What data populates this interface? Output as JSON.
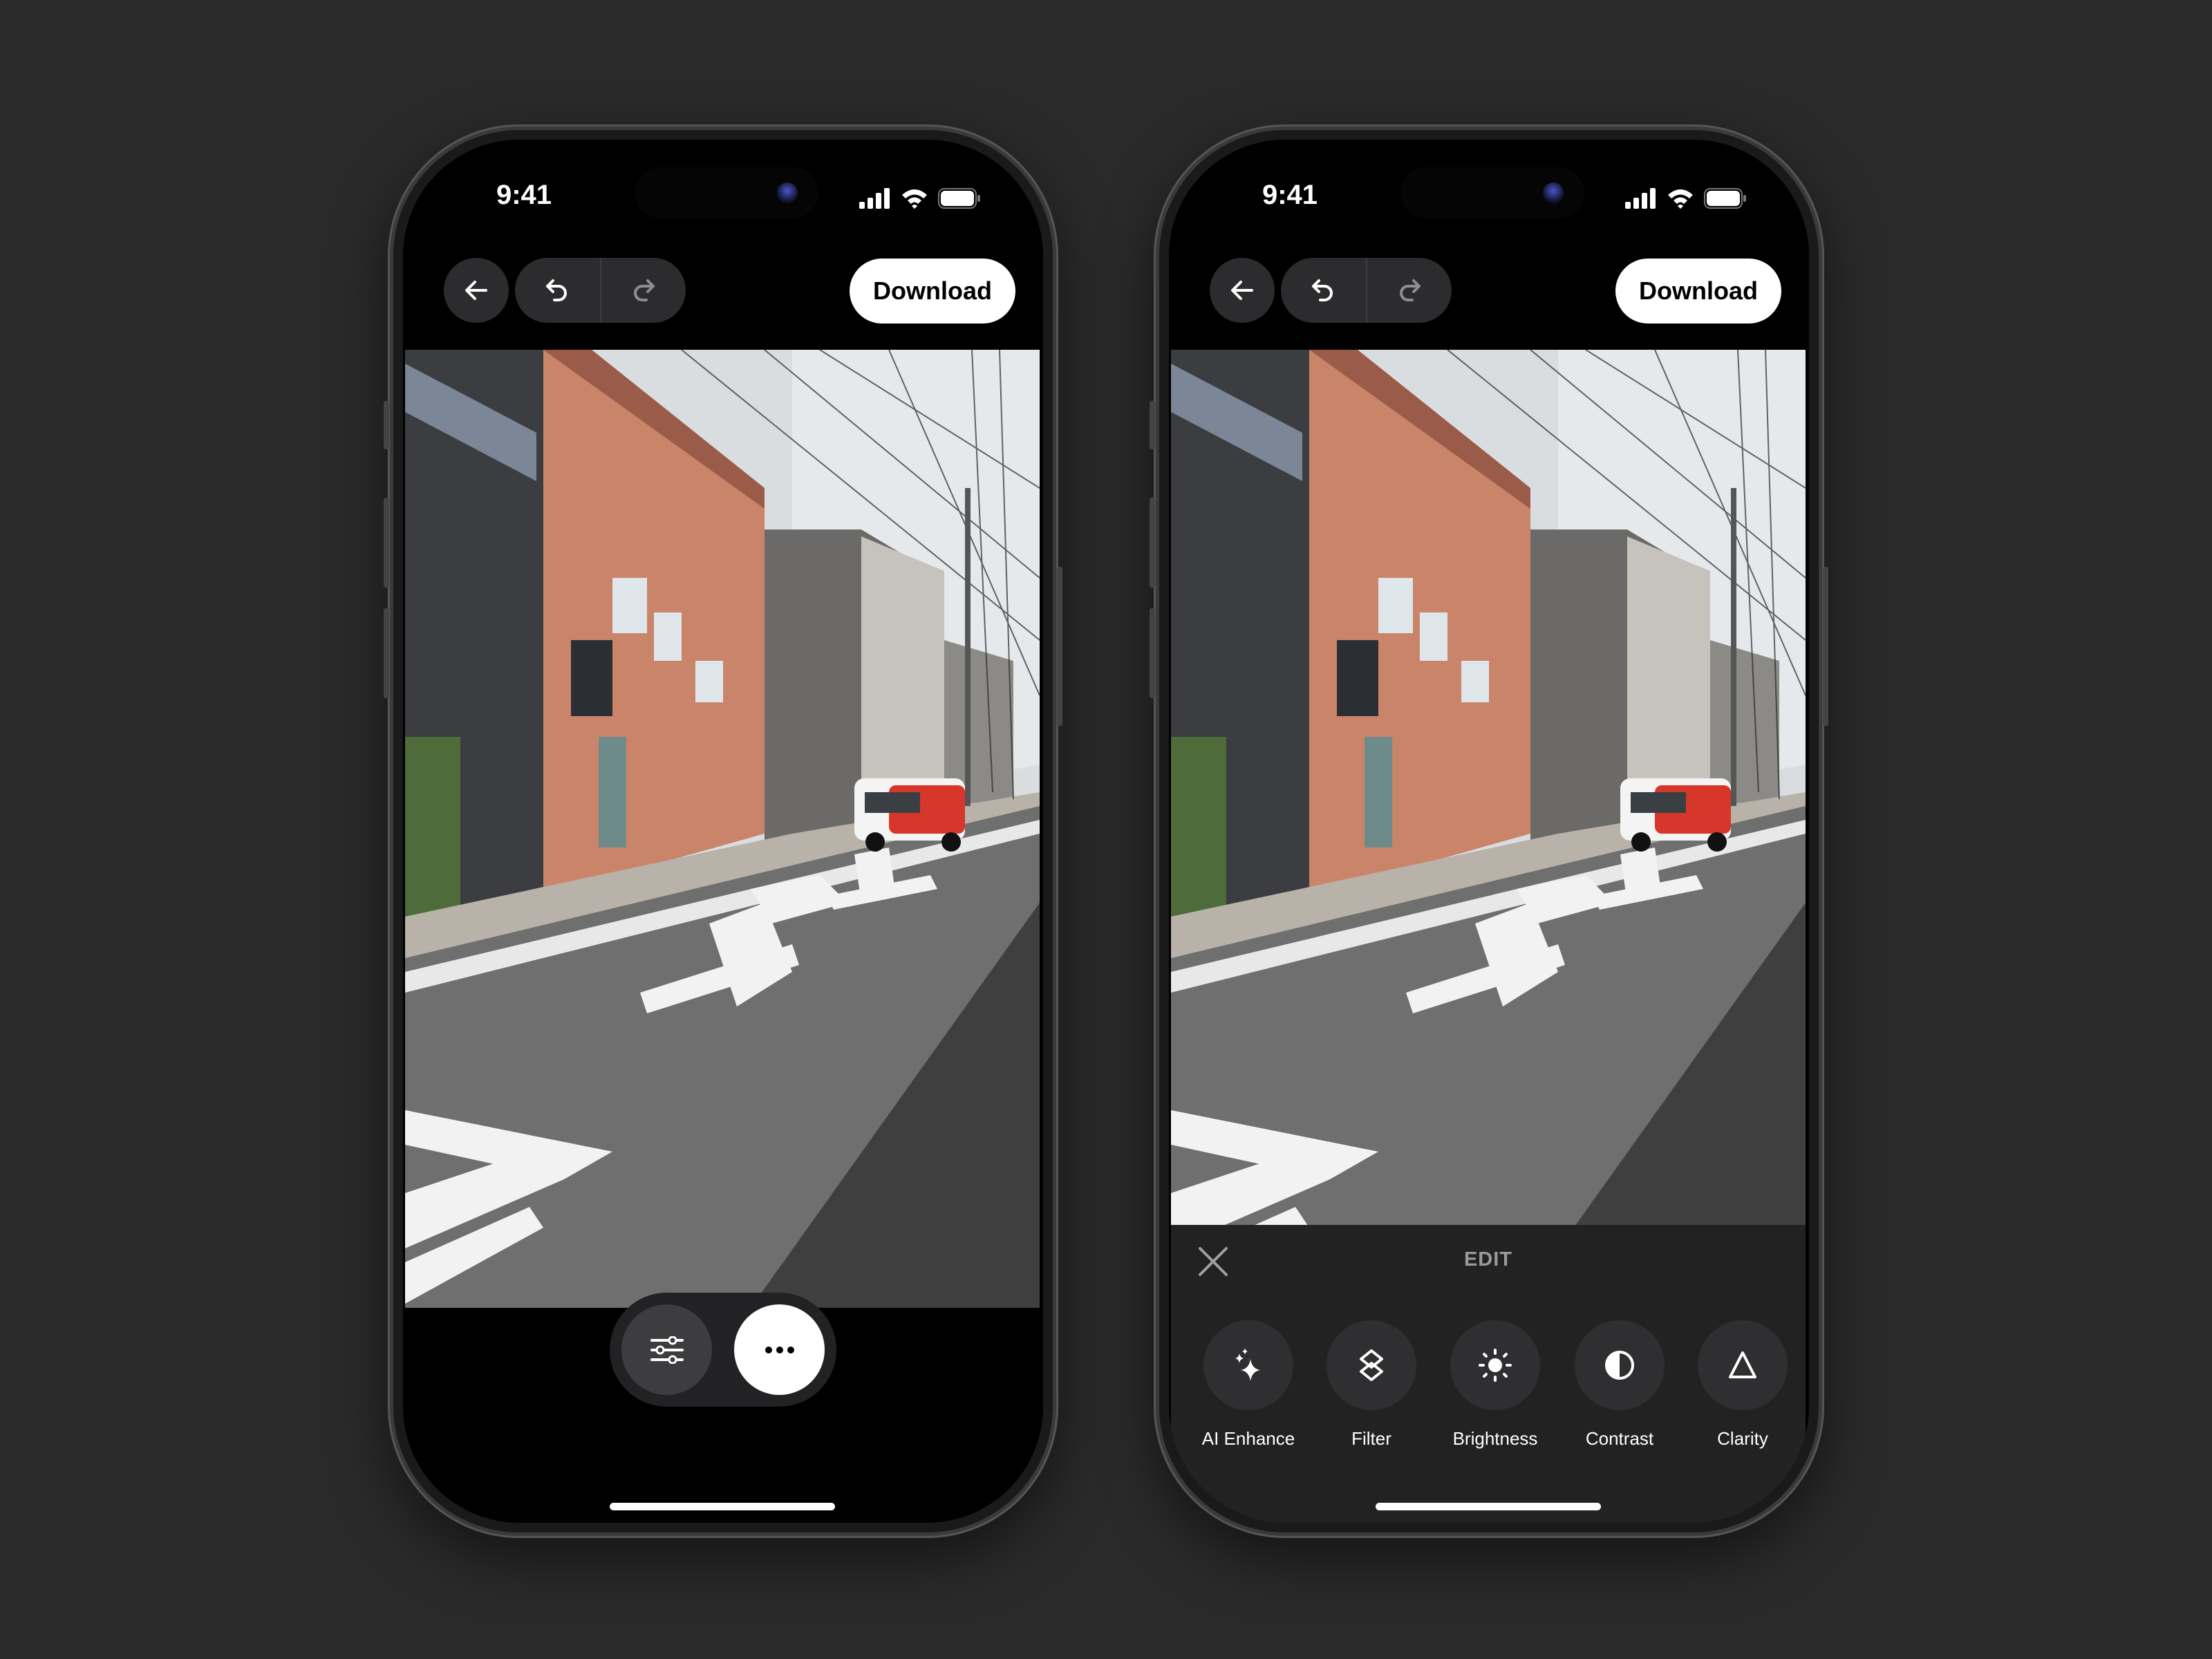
{
  "status_bar": {
    "time": "9:41",
    "icons": [
      "cellular-signal-icon",
      "wifi-icon",
      "battery-icon"
    ]
  },
  "toolbar": {
    "back_icon": "arrow-left-icon",
    "undo_icon": "undo-icon",
    "redo_icon": "redo-icon",
    "download_label": "Download"
  },
  "photo": {
    "subject": "street-photo"
  },
  "bottom_actions": {
    "adjust_icon": "sliders-icon",
    "more_icon": "ellipsis-icon"
  },
  "edit_panel": {
    "title": "EDIT",
    "close_icon": "close-icon",
    "tools": [
      {
        "label": "AI Enhance",
        "icon": "sparkles-icon"
      },
      {
        "label": "Filter",
        "icon": "layers-icon"
      },
      {
        "label": "Brightness",
        "icon": "sun-icon"
      },
      {
        "label": "Contrast",
        "icon": "contrast-icon"
      },
      {
        "label": "Clarity",
        "icon": "triangle-icon"
      }
    ]
  },
  "colors": {
    "background": "#2a2a2a",
    "button": "#2c2c2e",
    "panel": "#222222",
    "accent": "#ffffff"
  }
}
